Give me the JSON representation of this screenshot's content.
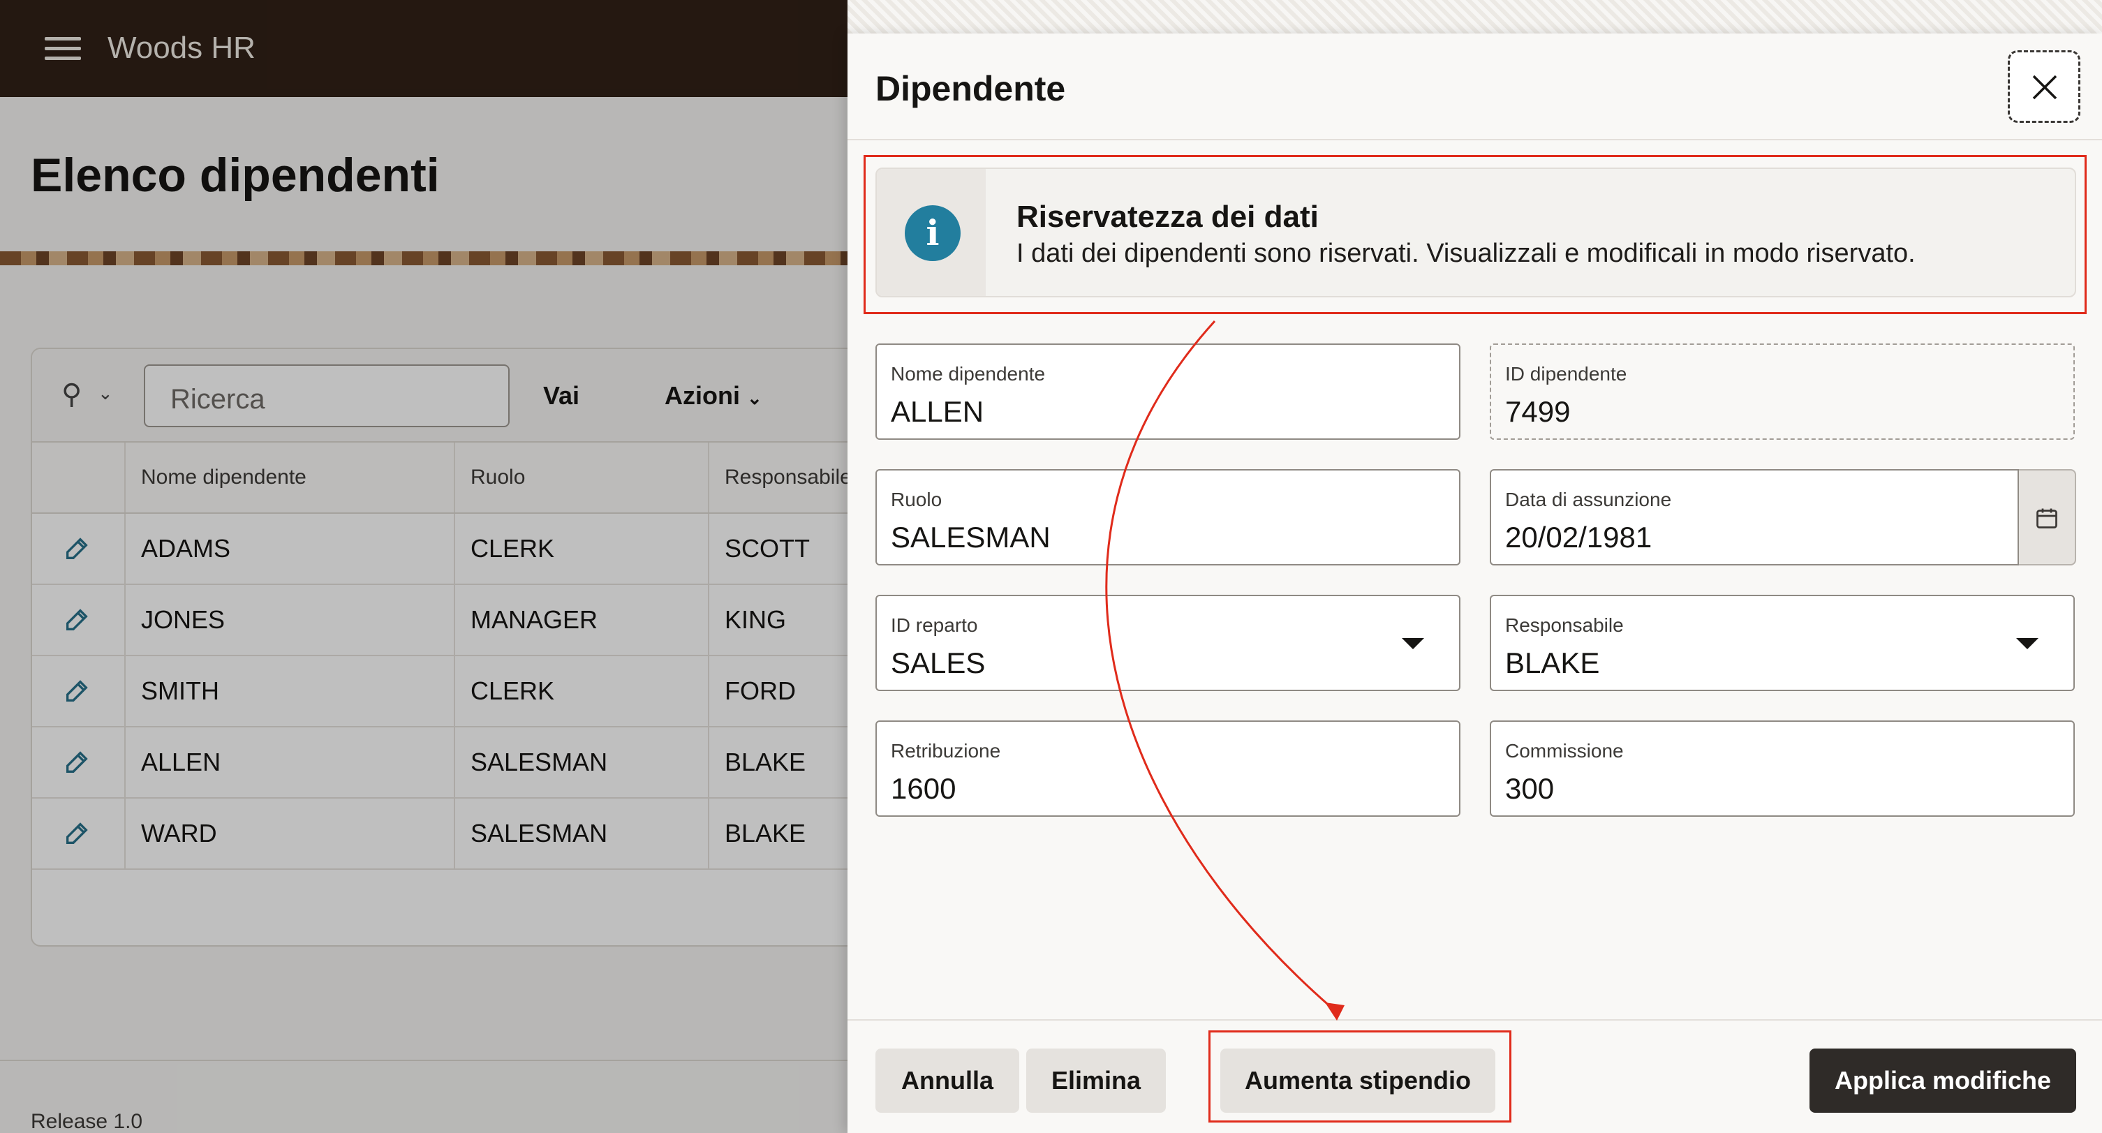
{
  "app": {
    "title": "Woods HR"
  },
  "page": {
    "title": "Elenco dipendenti",
    "release": "Release 1.0"
  },
  "toolbar": {
    "search_placeholder": "Ricerca",
    "go_label": "Vai",
    "actions_label": "Azioni"
  },
  "table": {
    "columns": [
      "Nome dipendente",
      "Ruolo",
      "Responsabile"
    ],
    "rows": [
      [
        "ADAMS",
        "CLERK",
        "SCOTT"
      ],
      [
        "JONES",
        "MANAGER",
        "KING"
      ],
      [
        "SMITH",
        "CLERK",
        "FORD"
      ],
      [
        "ALLEN",
        "SALESMAN",
        "BLAKE"
      ],
      [
        "WARD",
        "SALESMAN",
        "BLAKE"
      ]
    ]
  },
  "dialog": {
    "title": "Dipendente",
    "alert": {
      "title": "Riservatezza dei dati",
      "text": "I dati dei dipendenti sono riservati. Visualizzali e modificali in modo riservato."
    },
    "fields": {
      "name": {
        "label": "Nome dipendente",
        "value": "ALLEN"
      },
      "id": {
        "label": "ID dipendente",
        "value": "7499"
      },
      "role": {
        "label": "Ruolo",
        "value": "SALESMAN"
      },
      "hiredate": {
        "label": "Data di assunzione",
        "value": "20/02/1981"
      },
      "dept": {
        "label": "ID reparto",
        "value": "SALES"
      },
      "manager": {
        "label": "Responsabile",
        "value": "BLAKE"
      },
      "salary": {
        "label": "Retribuzione",
        "value": "1600"
      },
      "commission": {
        "label": "Commissione",
        "value": "300"
      }
    },
    "buttons": {
      "cancel": "Annulla",
      "delete": "Elimina",
      "raise": "Aumenta stipendio",
      "apply": "Applica modifiche"
    }
  },
  "colors": {
    "header": "#312017",
    "info": "#227e9e",
    "annotation": "#e02b1b",
    "primary_button": "#2f2b28"
  },
  "icons": [
    "menu-icon",
    "search-icon",
    "chevron-down-icon",
    "edit-icon",
    "close-icon",
    "info-icon",
    "calendar-icon",
    "caret-down-icon"
  ]
}
